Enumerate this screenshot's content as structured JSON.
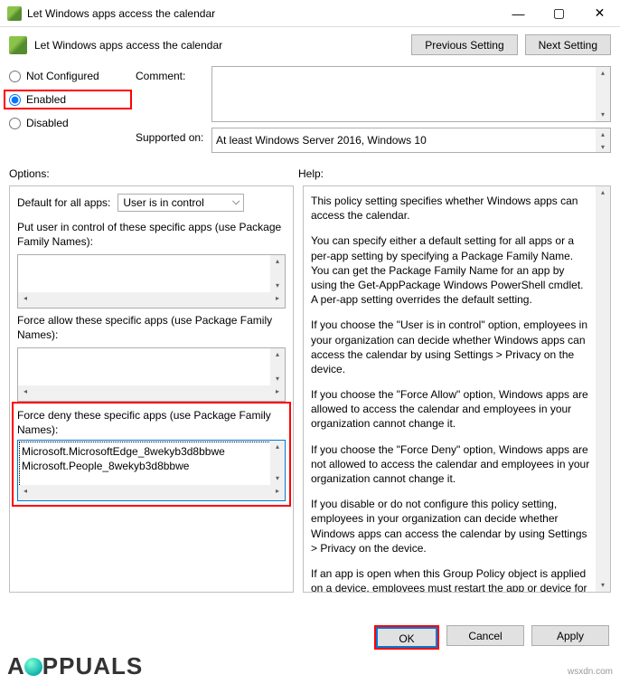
{
  "window": {
    "title": "Let Windows apps access the calendar",
    "header_title": "Let Windows apps access the calendar"
  },
  "nav": {
    "previous": "Previous Setting",
    "next": "Next Setting"
  },
  "radios": {
    "not_configured": "Not Configured",
    "enabled": "Enabled",
    "disabled": "Disabled"
  },
  "labels": {
    "comment": "Comment:",
    "supported_on": "Supported on:",
    "options": "Options:",
    "help": "Help:"
  },
  "supported_value": "At least Windows Server 2016, Windows 10",
  "options": {
    "default_label": "Default for all apps:",
    "default_value": "User is in control",
    "user_control_label": "Put user in control of these specific apps (use Package Family Names):",
    "force_allow_label": "Force allow these specific apps (use Package Family Names):",
    "force_deny_label": "Force deny these specific apps (use Package Family Names):",
    "deny_item1": "Microsoft.MicrosoftEdge_8wekyb3d8bbwe",
    "deny_item2": "Microsoft.People_8wekyb3d8bbwe"
  },
  "help_text": {
    "p1": "This policy setting specifies whether Windows apps can access the calendar.",
    "p2": "You can specify either a default setting for all apps or a per-app setting by specifying a Package Family Name. You can get the Package Family Name for an app by using the Get-AppPackage Windows PowerShell cmdlet. A per-app setting overrides the default setting.",
    "p3": "If you choose the \"User is in control\" option, employees in your organization can decide whether Windows apps can access the calendar by using Settings > Privacy on the device.",
    "p4": "If you choose the \"Force Allow\" option, Windows apps are allowed to access the calendar and employees in your organization cannot change it.",
    "p5": "If you choose the \"Force Deny\" option, Windows apps are not allowed to access the calendar and employees in your organization cannot change it.",
    "p6": "If you disable or do not configure this policy setting, employees in your organization can decide whether Windows apps can access the calendar by using Settings > Privacy on the device.",
    "p7": "If an app is open when this Group Policy object is applied on a device, employees must restart the app or device for the policy changes to be applied to the app."
  },
  "buttons": {
    "ok": "OK",
    "cancel": "Cancel",
    "apply": "Apply"
  },
  "watermark": {
    "brand": "PPUALS",
    "site": "wsxdn.com"
  }
}
